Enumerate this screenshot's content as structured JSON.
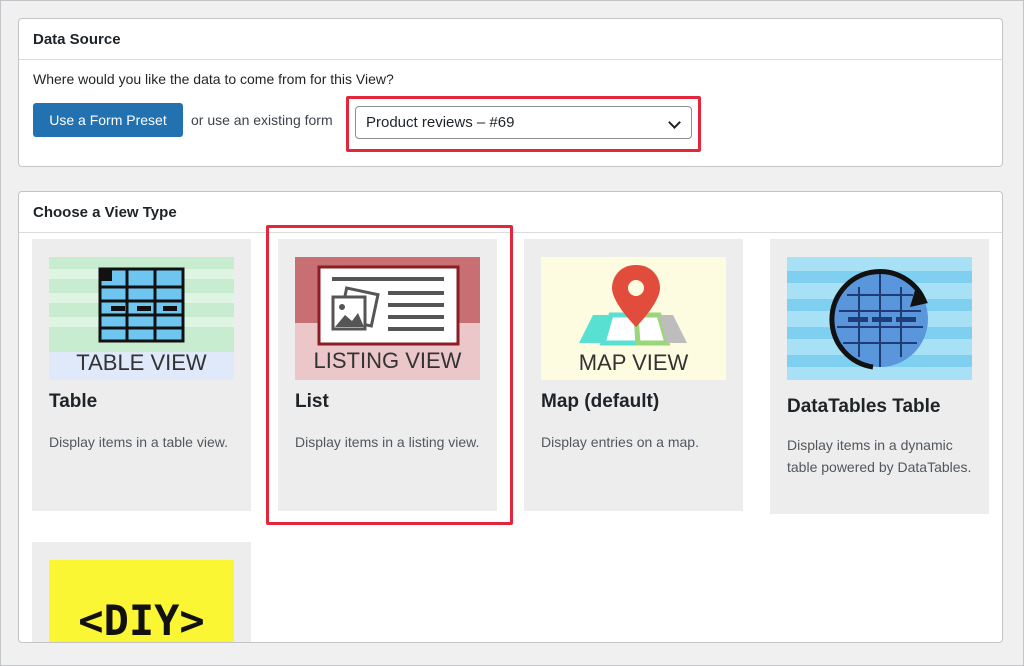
{
  "data_source": {
    "heading": "Data Source",
    "question": "Where would you like the data to come from for this View?",
    "preset_button": "Use a Form Preset",
    "or_text": "or use an existing form",
    "selected_form": "Product reviews – #69"
  },
  "view_type": {
    "heading": "Choose a View Type",
    "cards": [
      {
        "title": "Table",
        "description": "Display items in a table view.",
        "thumb_label": "TABLE VIEW",
        "icon": "table-view-icon"
      },
      {
        "title": "List",
        "description": "Display items in a listing view.",
        "thumb_label": "LISTING VIEW",
        "icon": "listing-view-icon"
      },
      {
        "title": "Map (default)",
        "description": "Display entries on a map.",
        "thumb_label": "MAP VIEW",
        "icon": "map-view-icon"
      },
      {
        "title": "DataTables Table",
        "description": "Display items in a dynamic table powered by DataTables.",
        "thumb_label": "",
        "icon": "datatables-icon"
      },
      {
        "title": "",
        "description": "",
        "thumb_label": "<DIY>",
        "icon": "diy-icon"
      }
    ]
  },
  "colors": {
    "primary_button": "#2271b1",
    "highlight": "#e3263c",
    "card_bg": "#ededed"
  }
}
